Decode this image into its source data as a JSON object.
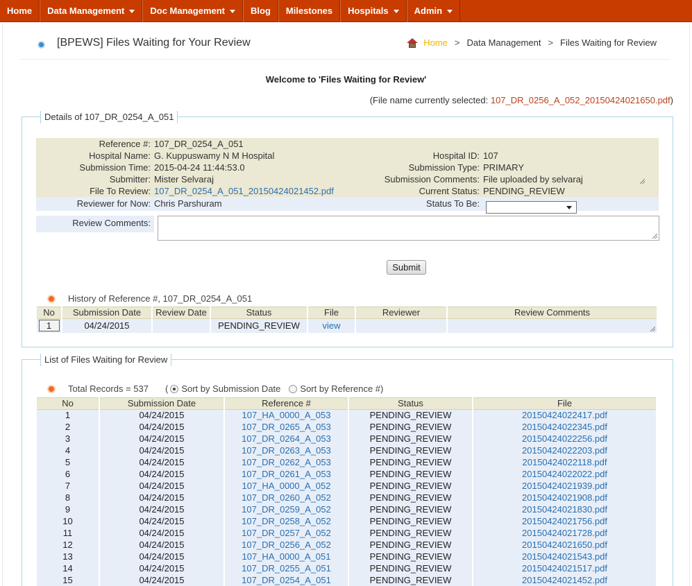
{
  "nav": {
    "items": [
      {
        "label": "Home",
        "dropdown": false
      },
      {
        "label": "Data Management",
        "dropdown": true
      },
      {
        "label": "Doc Management",
        "dropdown": true
      },
      {
        "label": "Blog",
        "dropdown": false
      },
      {
        "label": "Milestones",
        "dropdown": false
      },
      {
        "label": "Hospitals",
        "dropdown": true
      },
      {
        "label": "Admin",
        "dropdown": true
      }
    ]
  },
  "header": {
    "title": "[BPEWS] Files Waiting for Your Review",
    "breadcrumb": [
      "Home",
      "Data Management",
      "Files Waiting for Review"
    ]
  },
  "welcome": "Welcome to 'Files Waiting for Review'",
  "selected": {
    "prefix": "(File name currently selected: ",
    "file": "107_DR_0256_A_052_20150424021650.pdf",
    "suffix": ")"
  },
  "details": {
    "legend": "Details of 107_DR_0254_A_051",
    "reference_label": "Reference #:",
    "reference": "107_DR_0254_A_051",
    "hospital_name_label": "Hospital Name:",
    "hospital_name": "G. Kuppuswamy N M Hospital",
    "hospital_id_label": "Hospital ID:",
    "hospital_id": "107",
    "submission_time_label": "Submission Time:",
    "submission_time": "2015-04-24 11:44:53.0",
    "submission_type_label": "Submission Type:",
    "submission_type": "PRIMARY",
    "submitter_label": "Submitter:",
    "submitter": "Mister Selvaraj",
    "submission_comments_label": "Submission Comments:",
    "submission_comments": "File uploaded by selvaraj",
    "file_label": "File To Review:",
    "file": "107_DR_0254_A_051_20150424021452.pdf",
    "current_status_label": "Current Status:",
    "current_status": "PENDING_REVIEW",
    "reviewer_label": "Reviewer for Now:",
    "reviewer": "Chris Parshuram",
    "status_to_be_label": "Status To Be:",
    "status_to_be": "",
    "review_comments_label": "Review Comments:",
    "submit_label": "Submit"
  },
  "history": {
    "title": "History of Reference #, 107_DR_0254_A_051",
    "columns": [
      "No",
      "Submission Date",
      "Review Date",
      "Status",
      "File",
      "Reviewer",
      "Review Comments"
    ],
    "rows": [
      {
        "no": "1",
        "submission_date": "04/24/2015",
        "review_date": "",
        "status": "PENDING_REVIEW",
        "file": "view",
        "reviewer": "",
        "review_comments": ""
      }
    ]
  },
  "list": {
    "legend": "List of Files Waiting for Review",
    "total": "Total Records = 537",
    "sort_open": "(",
    "sort_by_date": "Sort by Submission Date",
    "sort_by_ref": "Sort by Reference #)",
    "columns": [
      "No",
      "Submission Date",
      "Reference #",
      "Status",
      "File"
    ],
    "rows": [
      {
        "no": "1",
        "date": "04/24/2015",
        "ref": "107_HA_0000_A_053",
        "status": "PENDING_REVIEW",
        "file": "20150424022417.pdf"
      },
      {
        "no": "2",
        "date": "04/24/2015",
        "ref": "107_DR_0265_A_053",
        "status": "PENDING_REVIEW",
        "file": "20150424022345.pdf"
      },
      {
        "no": "3",
        "date": "04/24/2015",
        "ref": "107_DR_0264_A_053",
        "status": "PENDING_REVIEW",
        "file": "20150424022256.pdf"
      },
      {
        "no": "4",
        "date": "04/24/2015",
        "ref": "107_DR_0263_A_053",
        "status": "PENDING_REVIEW",
        "file": "20150424022203.pdf"
      },
      {
        "no": "5",
        "date": "04/24/2015",
        "ref": "107_DR_0262_A_053",
        "status": "PENDING_REVIEW",
        "file": "20150424022118.pdf"
      },
      {
        "no": "6",
        "date": "04/24/2015",
        "ref": "107_DR_0261_A_053",
        "status": "PENDING_REVIEW",
        "file": "20150424022022.pdf"
      },
      {
        "no": "7",
        "date": "04/24/2015",
        "ref": "107_HA_0000_A_052",
        "status": "PENDING_REVIEW",
        "file": "20150424021939.pdf"
      },
      {
        "no": "8",
        "date": "04/24/2015",
        "ref": "107_DR_0260_A_052",
        "status": "PENDING_REVIEW",
        "file": "20150424021908.pdf"
      },
      {
        "no": "9",
        "date": "04/24/2015",
        "ref": "107_DR_0259_A_052",
        "status": "PENDING_REVIEW",
        "file": "20150424021830.pdf"
      },
      {
        "no": "10",
        "date": "04/24/2015",
        "ref": "107_DR_0258_A_052",
        "status": "PENDING_REVIEW",
        "file": "20150424021756.pdf"
      },
      {
        "no": "11",
        "date": "04/24/2015",
        "ref": "107_DR_0257_A_052",
        "status": "PENDING_REVIEW",
        "file": "20150424021728.pdf"
      },
      {
        "no": "12",
        "date": "04/24/2015",
        "ref": "107_DR_0256_A_052",
        "status": "PENDING_REVIEW",
        "file": "20150424021650.pdf"
      },
      {
        "no": "13",
        "date": "04/24/2015",
        "ref": "107_HA_0000_A_051",
        "status": "PENDING_REVIEW",
        "file": "20150424021543.pdf"
      },
      {
        "no": "14",
        "date": "04/24/2015",
        "ref": "107_DR_0255_A_051",
        "status": "PENDING_REVIEW",
        "file": "20150424021517.pdf"
      },
      {
        "no": "15",
        "date": "04/24/2015",
        "ref": "107_DR_0254_A_051",
        "status": "PENDING_REVIEW",
        "file": "20150424021452.pdf"
      }
    ]
  }
}
